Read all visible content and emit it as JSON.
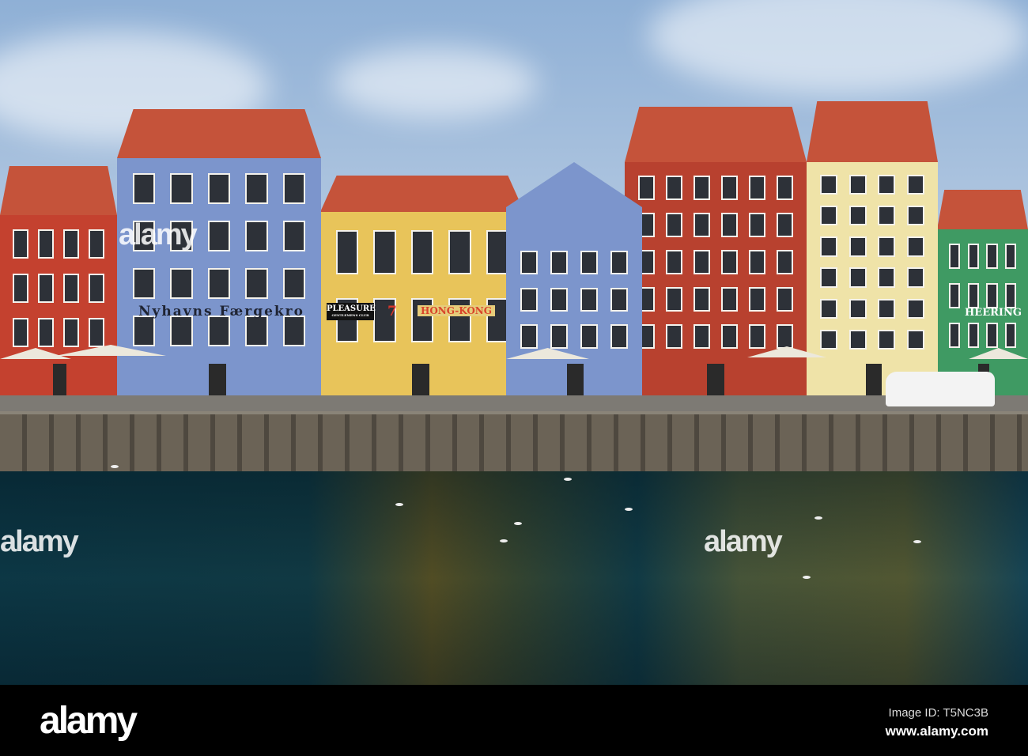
{
  "photo": {
    "signs": {
      "faergekro": "Nyhavns Færgekro",
      "pleasure": "PLEASURE",
      "pleasure_sub": "GENTLEMENS CLUB",
      "number": "7",
      "hongkong": "HONG-KONG",
      "heering": "HEERING"
    },
    "colors": {
      "sky": "#9db8da",
      "water": "#123c46",
      "red": "#c4412f",
      "blue": "#7c95cc",
      "yellow": "#e8c45a",
      "cream": "#efe3a8",
      "green": "#3f9a63"
    }
  },
  "watermark": {
    "text": "alamy"
  },
  "footer": {
    "logo": "alamy",
    "image_id": "Image ID: T5NC3B",
    "url": "www.alamy.com"
  }
}
